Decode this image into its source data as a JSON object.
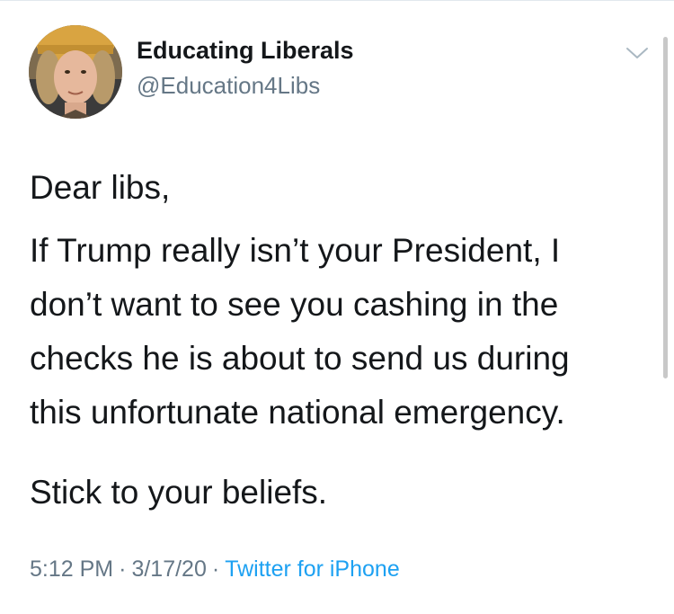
{
  "author": {
    "display_name": "Educating Liberals",
    "handle": "@Education4Libs",
    "avatar_icon": "profile-photo"
  },
  "menu": {
    "icon": "chevron-down-icon"
  },
  "tweet": {
    "greeting": "Dear libs,",
    "paragraph_lines": [
      "If Trump really isn’t your President, I",
      "don’t want to see you cashing in the",
      "checks he is about to send us during",
      "this unfortunate national emergency."
    ],
    "closing": "Stick to your beliefs."
  },
  "meta": {
    "time": "5:12 PM",
    "separator": "·",
    "date": "3/17/20",
    "source": "Twitter for iPhone"
  },
  "colors": {
    "text": "#14171a",
    "secondary": "#657786",
    "link": "#1da1f2"
  }
}
